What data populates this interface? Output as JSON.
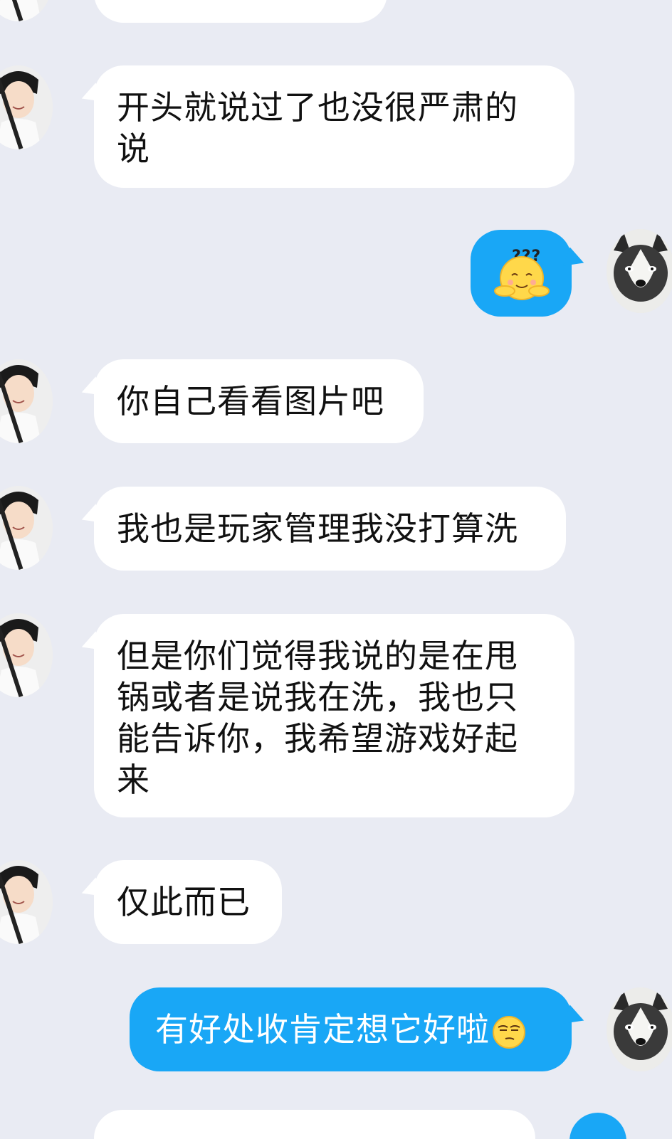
{
  "chat": {
    "messages": [
      {
        "id": "m1",
        "side": "left",
        "text": "开头就说过了也没很严肃的说"
      },
      {
        "id": "m2",
        "side": "right",
        "sticker": "confused-face-question-marks"
      },
      {
        "id": "m3",
        "side": "left",
        "text": "你自己看看图片吧"
      },
      {
        "id": "m4",
        "side": "left",
        "text": "我也是玩家管理我没打算洗"
      },
      {
        "id": "m5",
        "side": "left",
        "text": "但是你们觉得我说的是在甩锅或者是说我在洗，我也只能告诉你，我希望游戏好起来"
      },
      {
        "id": "m6",
        "side": "left",
        "text": "仅此而已"
      },
      {
        "id": "m7",
        "side": "right",
        "text": "有好处收肯定想它好啦",
        "emoji": "smirk-face"
      }
    ],
    "sticker_text": "???"
  },
  "colors": {
    "background": "#e9ebf3",
    "incoming_bubble": "#ffffff",
    "outgoing_bubble": "#19a7f6",
    "emoji_yellow": "#ffd84a"
  }
}
